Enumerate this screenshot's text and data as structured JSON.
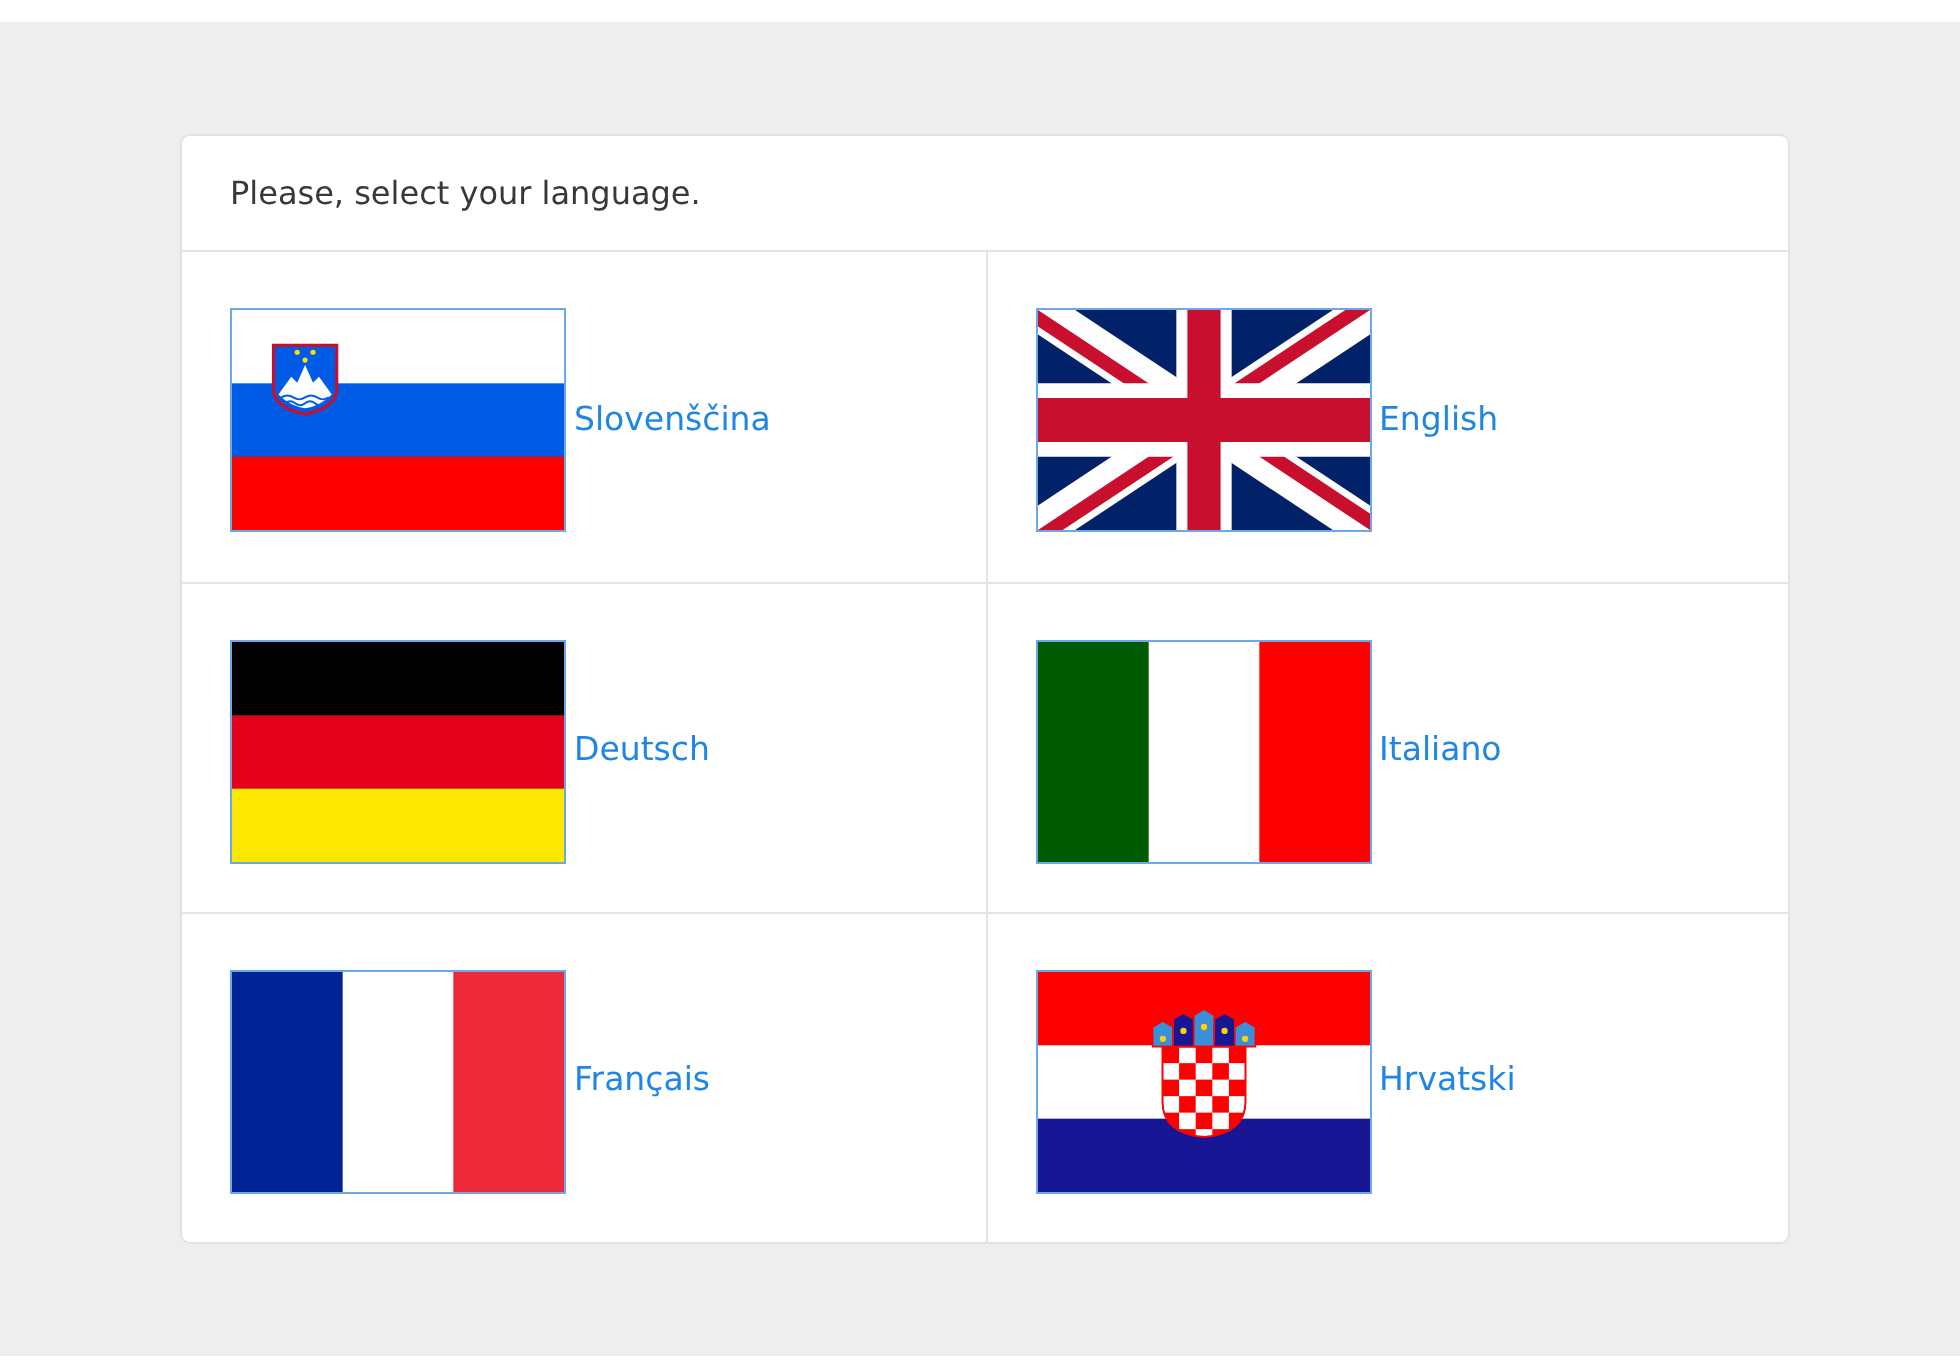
{
  "header": {
    "title": "Please, select your language."
  },
  "languages": [
    {
      "label": "Slovenščina",
      "kind": "slovenia"
    },
    {
      "label": "English",
      "kind": "uk"
    },
    {
      "label": "Deutsch",
      "kind": "germany"
    },
    {
      "label": "Italiano",
      "kind": "italy"
    },
    {
      "label": "Français",
      "kind": "france"
    },
    {
      "label": "Hrvatski",
      "kind": "croatia"
    }
  ]
}
